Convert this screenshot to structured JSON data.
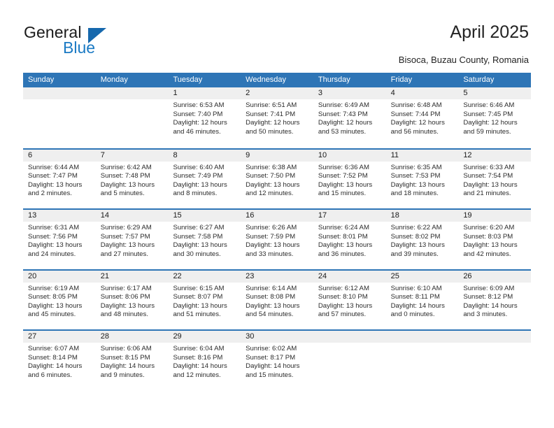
{
  "brand": {
    "name_top": "General",
    "name_bottom": "Blue",
    "logo_icon": "triangle-logo-icon",
    "accent_color": "#1668ad"
  },
  "header": {
    "title": "April 2025",
    "subtitle": "Bisoca, Buzau County, Romania"
  },
  "theme": {
    "header_blue": "#2e75b6",
    "day_band_gray": "#efefef",
    "text_color": "#2b2b2b"
  },
  "calendar": {
    "weekday_headers": [
      "Sunday",
      "Monday",
      "Tuesday",
      "Wednesday",
      "Thursday",
      "Friday",
      "Saturday"
    ],
    "weeks": [
      [
        {
          "day": "",
          "sunrise": "",
          "sunset": "",
          "daylight_1": "",
          "daylight_2": ""
        },
        {
          "day": "",
          "sunrise": "",
          "sunset": "",
          "daylight_1": "",
          "daylight_2": ""
        },
        {
          "day": "1",
          "sunrise": "Sunrise: 6:53 AM",
          "sunset": "Sunset: 7:40 PM",
          "daylight_1": "Daylight: 12 hours",
          "daylight_2": "and 46 minutes."
        },
        {
          "day": "2",
          "sunrise": "Sunrise: 6:51 AM",
          "sunset": "Sunset: 7:41 PM",
          "daylight_1": "Daylight: 12 hours",
          "daylight_2": "and 50 minutes."
        },
        {
          "day": "3",
          "sunrise": "Sunrise: 6:49 AM",
          "sunset": "Sunset: 7:43 PM",
          "daylight_1": "Daylight: 12 hours",
          "daylight_2": "and 53 minutes."
        },
        {
          "day": "4",
          "sunrise": "Sunrise: 6:48 AM",
          "sunset": "Sunset: 7:44 PM",
          "daylight_1": "Daylight: 12 hours",
          "daylight_2": "and 56 minutes."
        },
        {
          "day": "5",
          "sunrise": "Sunrise: 6:46 AM",
          "sunset": "Sunset: 7:45 PM",
          "daylight_1": "Daylight: 12 hours",
          "daylight_2": "and 59 minutes."
        }
      ],
      [
        {
          "day": "6",
          "sunrise": "Sunrise: 6:44 AM",
          "sunset": "Sunset: 7:47 PM",
          "daylight_1": "Daylight: 13 hours",
          "daylight_2": "and 2 minutes."
        },
        {
          "day": "7",
          "sunrise": "Sunrise: 6:42 AM",
          "sunset": "Sunset: 7:48 PM",
          "daylight_1": "Daylight: 13 hours",
          "daylight_2": "and 5 minutes."
        },
        {
          "day": "8",
          "sunrise": "Sunrise: 6:40 AM",
          "sunset": "Sunset: 7:49 PM",
          "daylight_1": "Daylight: 13 hours",
          "daylight_2": "and 8 minutes."
        },
        {
          "day": "9",
          "sunrise": "Sunrise: 6:38 AM",
          "sunset": "Sunset: 7:50 PM",
          "daylight_1": "Daylight: 13 hours",
          "daylight_2": "and 12 minutes."
        },
        {
          "day": "10",
          "sunrise": "Sunrise: 6:36 AM",
          "sunset": "Sunset: 7:52 PM",
          "daylight_1": "Daylight: 13 hours",
          "daylight_2": "and 15 minutes."
        },
        {
          "day": "11",
          "sunrise": "Sunrise: 6:35 AM",
          "sunset": "Sunset: 7:53 PM",
          "daylight_1": "Daylight: 13 hours",
          "daylight_2": "and 18 minutes."
        },
        {
          "day": "12",
          "sunrise": "Sunrise: 6:33 AM",
          "sunset": "Sunset: 7:54 PM",
          "daylight_1": "Daylight: 13 hours",
          "daylight_2": "and 21 minutes."
        }
      ],
      [
        {
          "day": "13",
          "sunrise": "Sunrise: 6:31 AM",
          "sunset": "Sunset: 7:56 PM",
          "daylight_1": "Daylight: 13 hours",
          "daylight_2": "and 24 minutes."
        },
        {
          "day": "14",
          "sunrise": "Sunrise: 6:29 AM",
          "sunset": "Sunset: 7:57 PM",
          "daylight_1": "Daylight: 13 hours",
          "daylight_2": "and 27 minutes."
        },
        {
          "day": "15",
          "sunrise": "Sunrise: 6:27 AM",
          "sunset": "Sunset: 7:58 PM",
          "daylight_1": "Daylight: 13 hours",
          "daylight_2": "and 30 minutes."
        },
        {
          "day": "16",
          "sunrise": "Sunrise: 6:26 AM",
          "sunset": "Sunset: 7:59 PM",
          "daylight_1": "Daylight: 13 hours",
          "daylight_2": "and 33 minutes."
        },
        {
          "day": "17",
          "sunrise": "Sunrise: 6:24 AM",
          "sunset": "Sunset: 8:01 PM",
          "daylight_1": "Daylight: 13 hours",
          "daylight_2": "and 36 minutes."
        },
        {
          "day": "18",
          "sunrise": "Sunrise: 6:22 AM",
          "sunset": "Sunset: 8:02 PM",
          "daylight_1": "Daylight: 13 hours",
          "daylight_2": "and 39 minutes."
        },
        {
          "day": "19",
          "sunrise": "Sunrise: 6:20 AM",
          "sunset": "Sunset: 8:03 PM",
          "daylight_1": "Daylight: 13 hours",
          "daylight_2": "and 42 minutes."
        }
      ],
      [
        {
          "day": "20",
          "sunrise": "Sunrise: 6:19 AM",
          "sunset": "Sunset: 8:05 PM",
          "daylight_1": "Daylight: 13 hours",
          "daylight_2": "and 45 minutes."
        },
        {
          "day": "21",
          "sunrise": "Sunrise: 6:17 AM",
          "sunset": "Sunset: 8:06 PM",
          "daylight_1": "Daylight: 13 hours",
          "daylight_2": "and 48 minutes."
        },
        {
          "day": "22",
          "sunrise": "Sunrise: 6:15 AM",
          "sunset": "Sunset: 8:07 PM",
          "daylight_1": "Daylight: 13 hours",
          "daylight_2": "and 51 minutes."
        },
        {
          "day": "23",
          "sunrise": "Sunrise: 6:14 AM",
          "sunset": "Sunset: 8:08 PM",
          "daylight_1": "Daylight: 13 hours",
          "daylight_2": "and 54 minutes."
        },
        {
          "day": "24",
          "sunrise": "Sunrise: 6:12 AM",
          "sunset": "Sunset: 8:10 PM",
          "daylight_1": "Daylight: 13 hours",
          "daylight_2": "and 57 minutes."
        },
        {
          "day": "25",
          "sunrise": "Sunrise: 6:10 AM",
          "sunset": "Sunset: 8:11 PM",
          "daylight_1": "Daylight: 14 hours",
          "daylight_2": "and 0 minutes."
        },
        {
          "day": "26",
          "sunrise": "Sunrise: 6:09 AM",
          "sunset": "Sunset: 8:12 PM",
          "daylight_1": "Daylight: 14 hours",
          "daylight_2": "and 3 minutes."
        }
      ],
      [
        {
          "day": "27",
          "sunrise": "Sunrise: 6:07 AM",
          "sunset": "Sunset: 8:14 PM",
          "daylight_1": "Daylight: 14 hours",
          "daylight_2": "and 6 minutes."
        },
        {
          "day": "28",
          "sunrise": "Sunrise: 6:06 AM",
          "sunset": "Sunset: 8:15 PM",
          "daylight_1": "Daylight: 14 hours",
          "daylight_2": "and 9 minutes."
        },
        {
          "day": "29",
          "sunrise": "Sunrise: 6:04 AM",
          "sunset": "Sunset: 8:16 PM",
          "daylight_1": "Daylight: 14 hours",
          "daylight_2": "and 12 minutes."
        },
        {
          "day": "30",
          "sunrise": "Sunrise: 6:02 AM",
          "sunset": "Sunset: 8:17 PM",
          "daylight_1": "Daylight: 14 hours",
          "daylight_2": "and 15 minutes."
        },
        {
          "day": "",
          "sunrise": "",
          "sunset": "",
          "daylight_1": "",
          "daylight_2": ""
        },
        {
          "day": "",
          "sunrise": "",
          "sunset": "",
          "daylight_1": "",
          "daylight_2": ""
        },
        {
          "day": "",
          "sunrise": "",
          "sunset": "",
          "daylight_1": "",
          "daylight_2": ""
        }
      ]
    ]
  }
}
